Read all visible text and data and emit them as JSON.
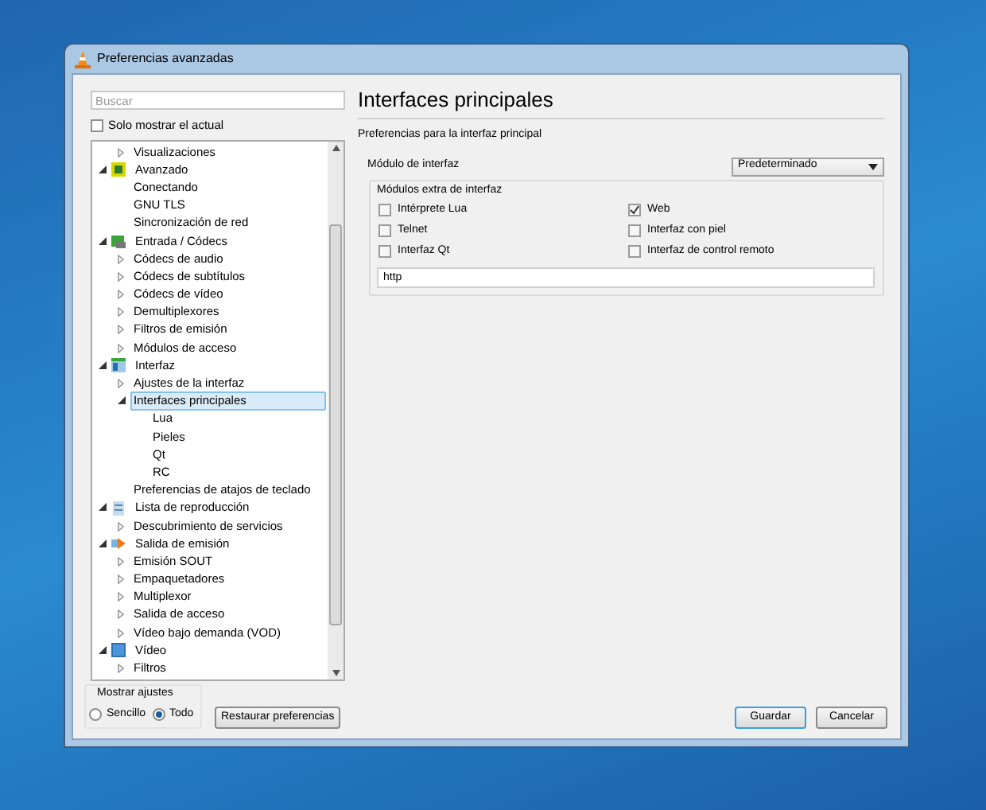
{
  "window": {
    "title": "Preferencias avanzadas"
  },
  "search": {
    "placeholder": "Buscar"
  },
  "only_current": {
    "label": "Solo mostrar el actual",
    "checked": false
  },
  "tree": [
    {
      "children": [
        {
          "label": "Visualizaciones",
          "expanded": false,
          "selected": false
        }
      ]
    },
    {
      "label": "Avanzado",
      "expanded": true,
      "selected": false,
      "children": [
        {
          "label": "Conectando",
          "selected": false
        },
        {
          "label": "GNU TLS",
          "selected": false
        },
        {
          "label": "Sincronización de red",
          "selected": false
        }
      ]
    },
    {
      "label": "Entrada / Códecs",
      "expanded": true,
      "selected": false,
      "children": [
        {
          "label": "Códecs de audio",
          "expanded": false,
          "selected": false
        },
        {
          "label": "Códecs de subtítulos",
          "expanded": false,
          "selected": false
        },
        {
          "label": "Códecs de vídeo",
          "expanded": false,
          "selected": false
        },
        {
          "label": "Demultiplexores",
          "expanded": false,
          "selected": false
        },
        {
          "label": "Filtros de emisión",
          "expanded": false,
          "selected": false
        },
        {
          "label": "Módulos de acceso",
          "expanded": false,
          "selected": false
        }
      ]
    },
    {
      "label": "Interfaz",
      "expanded": true,
      "selected": false,
      "children": [
        {
          "label": "Ajustes de la interfaz",
          "expanded": false,
          "selected": false
        },
        {
          "label": "Interfaces principales",
          "expanded": true,
          "selected": true,
          "children": [
            {
              "label": "Lua",
              "selected": false
            },
            {
              "label": "Pieles",
              "selected": false
            },
            {
              "label": "Qt",
              "selected": false
            },
            {
              "label": "RC",
              "selected": false
            }
          ]
        },
        {
          "label": "Preferencias de atajos de teclado",
          "selected": false
        }
      ]
    },
    {
      "label": "Lista de reproducción",
      "expanded": true,
      "selected": false,
      "children": [
        {
          "label": "Descubrimiento de servicios",
          "expanded": false,
          "selected": false
        }
      ]
    },
    {
      "label": "Salida de emisión",
      "expanded": true,
      "selected": false,
      "children": [
        {
          "label": "Emisión SOUT",
          "expanded": false,
          "selected": false
        },
        {
          "label": "Empaquetadores",
          "expanded": false,
          "selected": false
        },
        {
          "label": "Multiplexor",
          "expanded": false,
          "selected": false
        },
        {
          "label": "Salida de acceso",
          "expanded": false,
          "selected": false
        },
        {
          "label": "Vídeo bajo demanda (VOD)",
          "expanded": false,
          "selected": false
        }
      ]
    },
    {
      "label": "Vídeo",
      "expanded": true,
      "selected": false,
      "children": [
        {
          "label": "Filtros",
          "expanded": false,
          "selected": false
        }
      ]
    }
  ],
  "show_settings": {
    "title": "Mostrar ajustes",
    "options": [
      {
        "label": "Sencillo",
        "selected": false
      },
      {
        "label": "Todo",
        "selected": true
      }
    ]
  },
  "reset_button": "Restaurar preferencias",
  "panel": {
    "title": "Interfaces principales",
    "subtitle": "Preferencias para la interfaz principal",
    "module_label": "Módulo de interfaz",
    "module_value": "Predeterminado",
    "extra_group": {
      "title": "Módulos extra de interfaz",
      "options": [
        {
          "label": "Intérprete Lua",
          "checked": false
        },
        {
          "label": "Web",
          "checked": true
        },
        {
          "label": "Telnet",
          "checked": false
        },
        {
          "label": "Interfaz con piel",
          "checked": false
        },
        {
          "label": "Interfaz Qt",
          "checked": false
        },
        {
          "label": "Interfaz de control remoto",
          "checked": false
        }
      ],
      "value": "http"
    }
  },
  "buttons": [
    "Guardar",
    "Cancelar"
  ]
}
